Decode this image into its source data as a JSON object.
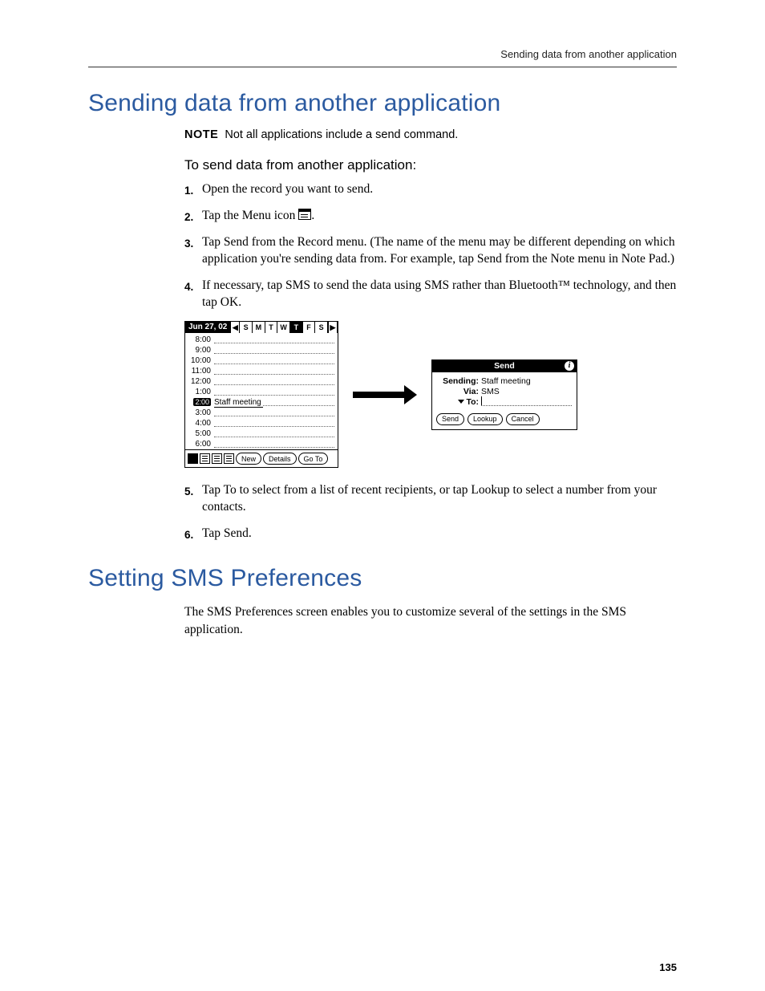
{
  "header": {
    "running": "Sending data from another application"
  },
  "section1": {
    "title": "Sending data from another application",
    "note_label": "NOTE",
    "note_text": "Not all applications include a send command.",
    "procedure_title": "To send data from another application:",
    "steps": {
      "s1": "Open the record you want to send.",
      "s2a": "Tap the Menu icon ",
      "s2b": ".",
      "s3": "Tap Send from the Record menu. (The name of the menu may be different depending on which application you're sending data from. For example, tap Send from the Note menu in Note Pad.)",
      "s4": "If necessary, tap SMS to send the data using SMS rather than Bluetooth™ technology, and then tap OK.",
      "s5": "Tap To to select from a list of recent recipients, or tap Lookup to select a number from your contacts.",
      "s6": "Tap Send."
    }
  },
  "palm": {
    "date": "Jun 27, 02",
    "weekdays": [
      "S",
      "M",
      "T",
      "W",
      "T",
      "F",
      "S"
    ],
    "selected_day_index": 4,
    "times": [
      "8:00",
      "9:00",
      "10:00",
      "11:00",
      "12:00",
      "1:00",
      "2:00",
      "3:00",
      "4:00",
      "5:00",
      "6:00"
    ],
    "event_time": "2:00",
    "event_text": "Staff meeting",
    "btn_new": "New",
    "btn_details": "Details",
    "btn_goto": "Go To"
  },
  "send": {
    "title": "Send",
    "sending_k": "Sending:",
    "sending_v": "Staff meeting",
    "via_k": "Via:",
    "via_v": "SMS",
    "to_k": "To:",
    "btn_send": "Send",
    "btn_lookup": "Lookup",
    "btn_cancel": "Cancel"
  },
  "section2": {
    "title": "Setting SMS Preferences",
    "intro": "The SMS Preferences screen enables you to customize several of the settings in the SMS application."
  },
  "page_number": "135"
}
